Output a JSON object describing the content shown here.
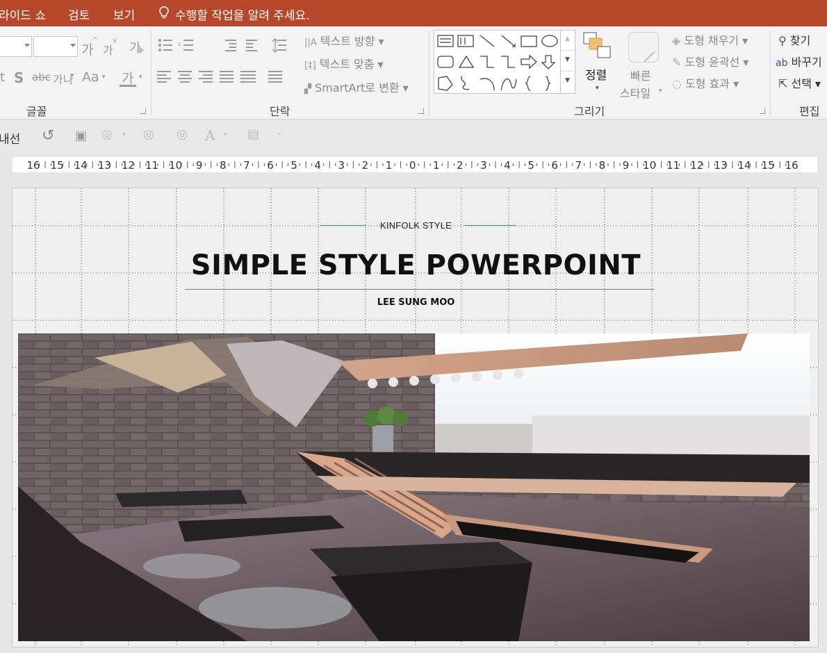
{
  "menu": {
    "items": [
      "라이드 쇼",
      "검토",
      "보기"
    ],
    "tell_me": "수행할 작업을 알려 주세요."
  },
  "ribbon": {
    "font_group": {
      "label": "글꼴",
      "grow_glyph": "가",
      "shrink_glyph": "가",
      "shadow_glyph": "S",
      "spacing_glyph": "가나",
      "case_glyph": "Aa",
      "color_glyph": "가"
    },
    "paragraph_group": {
      "label": "단락",
      "text_direction": "텍스트 방향",
      "align_text": "텍스트 맞춤",
      "smartart": "SmartArt로 변환"
    },
    "drawing_group": {
      "label": "그리기",
      "arrange": "정렬",
      "quick_styles_1": "빠른",
      "quick_styles_2": "스타일",
      "shape_fill": "도형 채우기",
      "shape_outline": "도형 윤곽선",
      "shape_effects": "도형 효과"
    },
    "editing_group": {
      "label": "편집",
      "find": "찾기",
      "replace": "바꾸기",
      "select": "선택"
    }
  },
  "quick_toolbar": {
    "left_label": "내선"
  },
  "ruler": {
    "ticks": [
      "16",
      "15",
      "14",
      "13",
      "12",
      "11",
      "10",
      "9",
      "8",
      "7",
      "6",
      "5",
      "4",
      "3",
      "2",
      "1",
      "0",
      "1",
      "2",
      "3",
      "4",
      "5",
      "6",
      "7",
      "8",
      "9",
      "10",
      "11",
      "12",
      "13",
      "14",
      "15",
      "16"
    ]
  },
  "slide": {
    "kicker": "KINFOLK STYLE",
    "title": "SIMPLE STYLE POWERPOINT",
    "author": "LEE SUNG MOO"
  },
  "colors": {
    "menubar": "#b7472a",
    "accent_line": "#5b86b8"
  }
}
